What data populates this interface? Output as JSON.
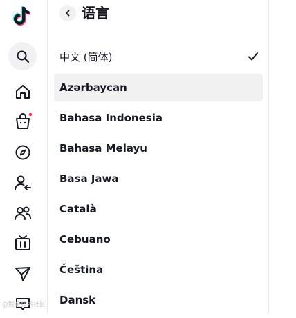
{
  "app": {
    "brand_colors": {
      "text": "#161823",
      "hover_bg": "#f1f1f2",
      "divider": "#e6e6e8",
      "logo_cyan": "#25f4ee",
      "logo_red": "#fe2c55",
      "notification_dot": "#fe2c55"
    }
  },
  "sidebar": {
    "icons": [
      {
        "name": "tiktok-logo"
      },
      {
        "name": "search-icon"
      },
      {
        "name": "home-icon"
      },
      {
        "name": "shop-icon",
        "has_notification_dot": true
      },
      {
        "name": "explore-icon"
      },
      {
        "name": "following-icon"
      },
      {
        "name": "friends-icon"
      },
      {
        "name": "live-icon"
      },
      {
        "name": "messages-icon"
      },
      {
        "name": "inbox-icon"
      }
    ]
  },
  "header": {
    "title": "语言",
    "back_icon": "chevron-left-icon"
  },
  "languages": {
    "selected": "中文 (简体)",
    "hovered": "Azərbaycan",
    "items": [
      "中文 (简体)",
      "Azərbaycan",
      "Bahasa Indonesia",
      "Bahasa Melayu",
      "Basa Jawa",
      "Català",
      "Cebuano",
      "Čeština",
      "Dansk"
    ]
  },
  "watermark": {
    "text": "@掘金技术社区"
  }
}
